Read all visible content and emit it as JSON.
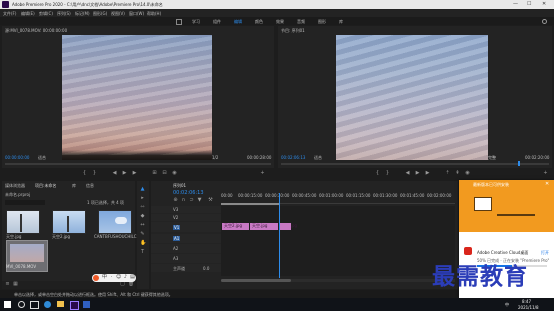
{
  "title_bar": {
    "title": "Adobe Premiere Pro 2020 - C:\\用户\\dnc\\文档\\Adobe\\Premiere Pro\\14.0\\未命名",
    "minimize": "—",
    "maximize": "☐",
    "close": "✕"
  },
  "menu": [
    "文件(F)",
    "编辑(E)",
    "剪辑(C)",
    "序列(S)",
    "标记(M)",
    "图形(G)",
    "视图(V)",
    "窗口(W)",
    "帮助(H)"
  ],
  "workspaces": [
    "学习",
    "组件",
    "编辑",
    "颜色",
    "效果",
    "音频",
    "图形",
    "库"
  ],
  "source_monitor": {
    "tab": "源:MVI_0078.MOV: 00:00:00:00",
    "timecode": "00:00:00:00",
    "fit": "适合",
    "scale": "1/2",
    "duration": "00:00:28:00"
  },
  "program_monitor": {
    "tab": "节目: 序列01",
    "timecode": "00:02:06:13",
    "fit": "适合",
    "scale": "完整",
    "duration": "00:02:20:00"
  },
  "project_panel": {
    "tabs": [
      "项目:未命名",
      "媒体浏览器",
      "库",
      "信息"
    ],
    "project_name": "未命名.prproj",
    "selection": "1 项已选择，共 4 项",
    "clips": [
      {
        "name": "天空.jpg",
        "duration": "5:00"
      },
      {
        "name": "天空2.jpg",
        "duration": "5:00"
      },
      {
        "name": "CANTBFUSHOUCHILCHEN...",
        "duration": "5:00"
      },
      {
        "name": "MVI_0078.MOV",
        "duration": "28:00"
      }
    ]
  },
  "timeline": {
    "tab": "序列01",
    "timecode": "00:02:06:13",
    "ruler": [
      "00:00",
      "00:00:15:00",
      "00:00:30:00",
      "00:00:45:00",
      "00:01:00:00",
      "00:01:15:00",
      "00:01:30:00",
      "00:01:45:00",
      "00:02:00:00"
    ],
    "video_tracks": [
      "V3",
      "V2",
      "V1"
    ],
    "audio_tracks": [
      "A1",
      "A2",
      "A3"
    ],
    "master": "主声道",
    "master_value": "0.0",
    "clips": [
      "天空2.jpg",
      "天空.jpg",
      "天空3.jpg"
    ]
  },
  "status_bar": {
    "text": "单击以选择，或单击空白处并拖动以进行框选。使用 Shift、Alt 和 Ctrl 键获得其他选项。"
  },
  "notification": {
    "header": "最新版本已可供安装",
    "app_name": "Adobe Creative Cloud桌面",
    "action": "打开",
    "subtitle": "50% 已完成 · 正在安装 \"Premiere Pro\"",
    "progress": 0.5
  },
  "watermark": "最需教育",
  "taskbar": {
    "time": "8:47",
    "date": "2021/11/8",
    "lang": "中"
  },
  "colors": {
    "accent": "#2d8ceb",
    "clip": "#c879c4",
    "notif_orange": "#f29a1f",
    "playhead": "#2d8ceb"
  }
}
